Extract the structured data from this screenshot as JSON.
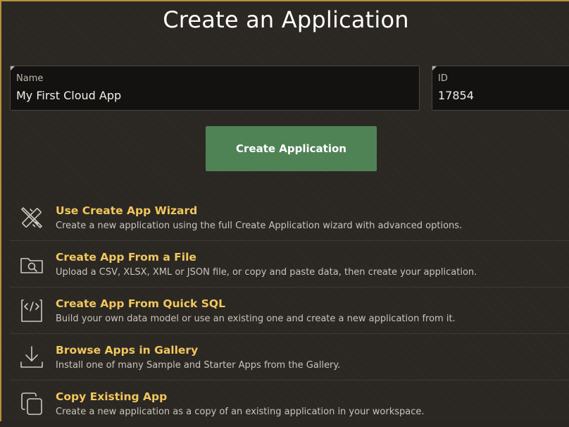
{
  "page_title": "Create an Application",
  "name_field": {
    "label": "Name",
    "value": "My First Cloud App"
  },
  "id_field": {
    "label": "ID",
    "value": "17854"
  },
  "create_button_label": "Create Application",
  "options": [
    {
      "icon": "wizard-icon",
      "title": "Use Create App Wizard",
      "description": "Create a new application using the full Create Application wizard with advanced options."
    },
    {
      "icon": "file-folder-search-icon",
      "title": "Create App From a File",
      "description": "Upload a CSV, XLSX, XML or JSON file, or copy and paste data, then create your application."
    },
    {
      "icon": "code-icon",
      "title": "Create App From Quick SQL",
      "description": "Build your own data model or use an existing one and create a new application from it."
    },
    {
      "icon": "download-icon",
      "title": "Browse Apps in Gallery",
      "description": "Install one of many Sample and Starter Apps from the Gallery."
    },
    {
      "icon": "copy-icon",
      "title": "Copy Existing App",
      "description": "Create a new application as a copy of an existing application in your workspace."
    }
  ],
  "colors": {
    "accent_gold": "#f2c75c",
    "button_green": "#4f8356",
    "background": "#2b2723",
    "frame_border": "#b8913a"
  }
}
